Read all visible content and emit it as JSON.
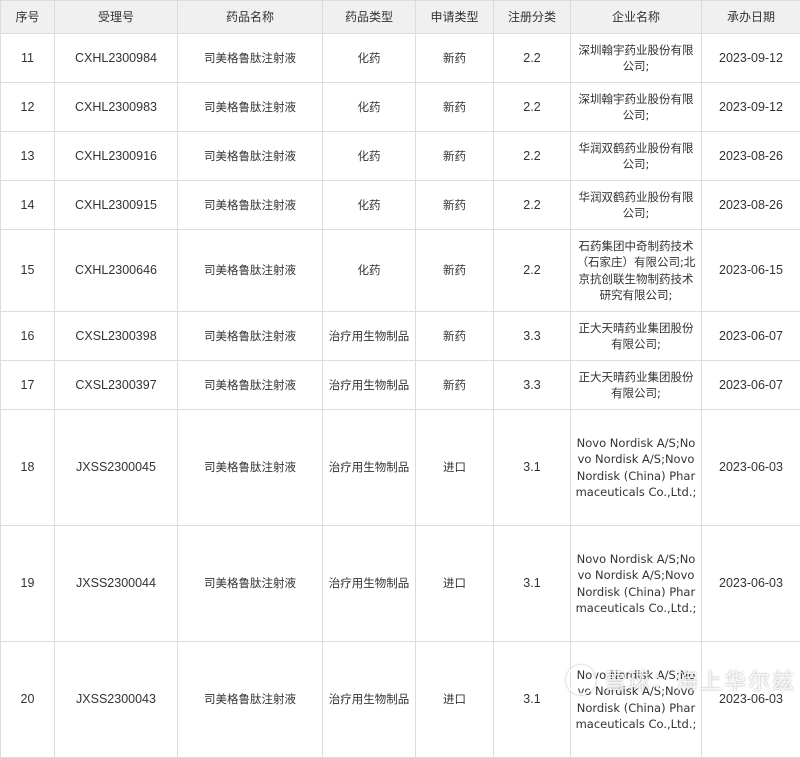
{
  "table": {
    "headers": [
      "序号",
      "受理号",
      "药品名称",
      "药品类型",
      "申请类型",
      "注册分类",
      "企业名称",
      "承办日期"
    ],
    "rows": [
      {
        "seq": "11",
        "accept_no": "CXHL2300984",
        "drug_name": "司美格鲁肽注射液",
        "drug_type": "化药",
        "app_type": "新药",
        "reg_class": "2.2",
        "company": "深圳翰宇药业股份有限公司;",
        "date": "2023-09-12"
      },
      {
        "seq": "12",
        "accept_no": "CXHL2300983",
        "drug_name": "司美格鲁肽注射液",
        "drug_type": "化药",
        "app_type": "新药",
        "reg_class": "2.2",
        "company": "深圳翰宇药业股份有限公司;",
        "date": "2023-09-12"
      },
      {
        "seq": "13",
        "accept_no": "CXHL2300916",
        "drug_name": "司美格鲁肽注射液",
        "drug_type": "化药",
        "app_type": "新药",
        "reg_class": "2.2",
        "company": "华润双鹤药业股份有限公司;",
        "date": "2023-08-26"
      },
      {
        "seq": "14",
        "accept_no": "CXHL2300915",
        "drug_name": "司美格鲁肽注射液",
        "drug_type": "化药",
        "app_type": "新药",
        "reg_class": "2.2",
        "company": "华润双鹤药业股份有限公司;",
        "date": "2023-08-26"
      },
      {
        "seq": "15",
        "accept_no": "CXHL2300646",
        "drug_name": "司美格鲁肽注射液",
        "drug_type": "化药",
        "app_type": "新药",
        "reg_class": "2.2",
        "company": "石药集团中奇制药技术（石家庄）有限公司;北京抗创联生物制药技术研究有限公司;",
        "date": "2023-06-15"
      },
      {
        "seq": "16",
        "accept_no": "CXSL2300398",
        "drug_name": "司美格鲁肽注射液",
        "drug_type": "治疗用生物制品",
        "app_type": "新药",
        "reg_class": "3.3",
        "company": "正大天晴药业集团股份有限公司;",
        "date": "2023-06-07"
      },
      {
        "seq": "17",
        "accept_no": "CXSL2300397",
        "drug_name": "司美格鲁肽注射液",
        "drug_type": "治疗用生物制品",
        "app_type": "新药",
        "reg_class": "3.3",
        "company": "正大天晴药业集团股份有限公司;",
        "date": "2023-06-07"
      },
      {
        "seq": "18",
        "accept_no": "JXSS2300045",
        "drug_name": "司美格鲁肽注射液",
        "drug_type": "治疗用生物制品",
        "app_type": "进口",
        "reg_class": "3.1",
        "company": "Novo Nordisk A/S;Novo Nordisk A/S;Novo Nordisk (China) Pharmaceuticals Co.,Ltd.;",
        "date": "2023-06-03"
      },
      {
        "seq": "19",
        "accept_no": "JXSS2300044",
        "drug_name": "司美格鲁肽注射液",
        "drug_type": "治疗用生物制品",
        "app_type": "进口",
        "reg_class": "3.1",
        "company": "Novo Nordisk A/S;Novo Nordisk A/S;Novo Nordisk (China) Pharmaceuticals Co.,Ltd.;",
        "date": "2023-06-03"
      },
      {
        "seq": "20",
        "accept_no": "JXSS2300043",
        "drug_name": "司美格鲁肽注射液",
        "drug_type": "治疗用生物制品",
        "app_type": "进口",
        "reg_class": "3.1",
        "company": "Novo Nordisk A/S;Novo Nordisk A/S;Novo Nordisk (China) Pharmaceuticals Co.,Ltd.;",
        "date": "2023-06-03"
      }
    ]
  },
  "watermark": {
    "text": "雪球：海上华尔兹"
  }
}
